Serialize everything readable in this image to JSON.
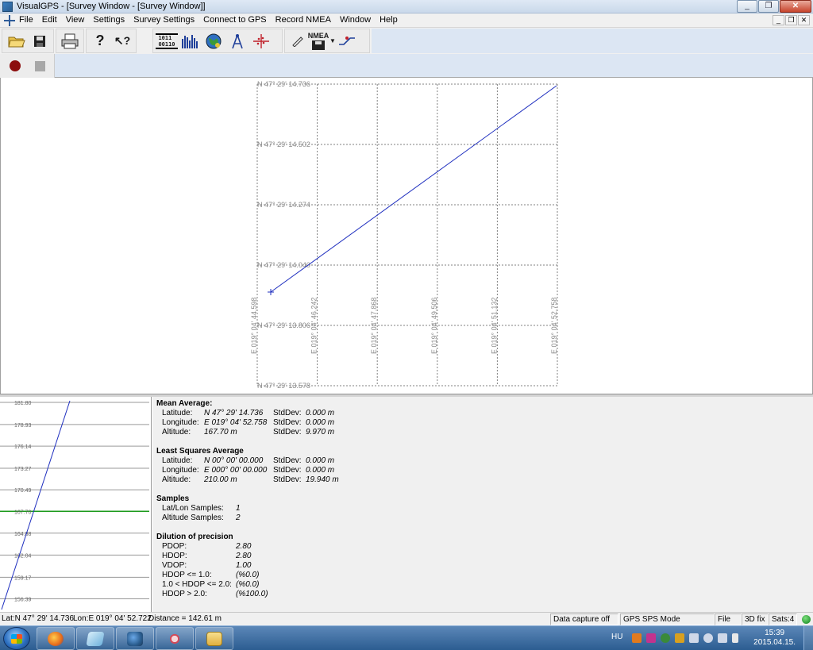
{
  "window": {
    "title": "VisualGPS - [Survey Window - [Survey Window]]"
  },
  "caption_buttons": [
    "_",
    "❐",
    "✕"
  ],
  "mdi_buttons": [
    "_",
    "❐",
    "✕"
  ],
  "menu": {
    "items": [
      "File",
      "Edit",
      "View",
      "Settings",
      "Survey Settings",
      "Connect to GPS",
      "Record NMEA",
      "Window",
      "Help"
    ]
  },
  "toolbar": {
    "buttons": [
      {
        "name": "open-folder-icon"
      },
      {
        "name": "save-disk-icon"
      },
      {
        "name": "printer-icon"
      },
      {
        "name": "help-icon",
        "glyph": "?"
      },
      {
        "name": "context-help-icon",
        "glyph": "↖?"
      },
      {
        "name": "binary-data-icon",
        "glyph": "1011\n00110"
      },
      {
        "name": "signal-bars-icon"
      },
      {
        "name": "globe-icon"
      },
      {
        "name": "compass-icon"
      },
      {
        "name": "survey-scatter-icon"
      },
      {
        "name": "pen-icon"
      },
      {
        "name": "nmea-record-icon",
        "glyph": "NMEA"
      },
      {
        "name": "connection-icon"
      }
    ],
    "record_buttons": [
      "record-icon",
      "stop-icon"
    ]
  },
  "survey_plot": {
    "lat_labels": [
      "N 47° 29' 14.736",
      "N 47° 29' 14.502",
      "N 47° 29' 14.274",
      "N 47° 29' 14.040",
      "N 47° 29' 13.806",
      "N 47° 29' 13.578"
    ],
    "lon_labels": [
      "E 019° 04' 44.598",
      "E 019° 04' 46.242",
      "E 019° 04' 47.868",
      "E 019° 04' 49.506",
      "E 019° 04' 51.132",
      "E 019° 04' 52.758"
    ],
    "track_color": "#1f2fbf",
    "grid_color": "#808080"
  },
  "chart_data": {
    "type": "line",
    "title": "",
    "ylabel": "",
    "y_ticks": [
      181.8,
      178.93,
      176.14,
      173.27,
      170.49,
      167.7,
      164.88,
      162.04,
      159.17,
      156.39
    ],
    "ylim": [
      155.0,
      182.0
    ],
    "mean_line": 167.7,
    "series": [
      {
        "values": [
          155.0,
          182.0
        ]
      }
    ],
    "line_color": "#1f2fbf",
    "mean_color": "#1c9a1c"
  },
  "stats": {
    "mean_average": {
      "title": "Mean Average:",
      "rows": [
        {
          "label": "Latitude:",
          "value": "N 47° 29' 14.736",
          "stddev_label": "StdDev:",
          "stddev": "0.000 m"
        },
        {
          "label": "Longitude:",
          "value": "E 019° 04' 52.758",
          "stddev_label": "StdDev:",
          "stddev": "0.000 m"
        },
        {
          "label": "Altitude:",
          "value": "167.70  m",
          "stddev_label": "StdDev:",
          "stddev": "9.970 m"
        }
      ]
    },
    "least_squares": {
      "title": "Least Squares Average",
      "rows": [
        {
          "label": "Latitude:",
          "value": "N 00° 00' 00.000",
          "stddev_label": "StdDev:",
          "stddev": "0.000 m"
        },
        {
          "label": "Longitude:",
          "value": "E 000° 00' 00.000",
          "stddev_label": "StdDev:",
          "stddev": "0.000 m"
        },
        {
          "label": "Altitude:",
          "value": "210.00  m",
          "stddev_label": "StdDev:",
          "stddev": "19.940 m"
        }
      ]
    },
    "samples": {
      "title": "Samples",
      "rows": [
        {
          "label": "Lat/Lon Samples:",
          "value": "1"
        },
        {
          "label": "Altitude Samples:",
          "value": "2"
        }
      ]
    },
    "dop": {
      "title": "Dilution of precision",
      "rows": [
        {
          "label": "PDOP:",
          "value": "2.80"
        },
        {
          "label": "HDOP:",
          "value": "2.80"
        },
        {
          "label": "VDOP:",
          "value": "1.00"
        },
        {
          "label": "HDOP <= 1.0:",
          "value": "(%0.0)"
        },
        {
          "label": "1.0 < HDOP <= 2.0:",
          "value": "(%0.0)"
        },
        {
          "label": "HDOP > 2.0:",
          "value": "(%100.0)"
        }
      ]
    }
  },
  "status": {
    "lat": "Lat:N 47° 29' 14.736",
    "lon": "Lon:E 019° 04' 52.722",
    "distance": "Distance = 142.61 m",
    "capture": "Data capture off",
    "mode": "GPS SPS Mode",
    "source": "File",
    "fix": "3D fix",
    "sats": "Sats:4"
  },
  "taskbar": {
    "apps": [
      {
        "name": "firefox-icon",
        "color": "#e66a1a"
      },
      {
        "name": "notes-icon",
        "color": "#8fc7e8"
      },
      {
        "name": "visualgps-icon",
        "color": "#2a5d8f"
      },
      {
        "name": "snipping-tool-icon",
        "color": "#d14a5a"
      },
      {
        "name": "explorer-icon",
        "color": "#f0c860"
      }
    ],
    "language": "HU",
    "time": "15:39",
    "date": "2015.04.15."
  }
}
